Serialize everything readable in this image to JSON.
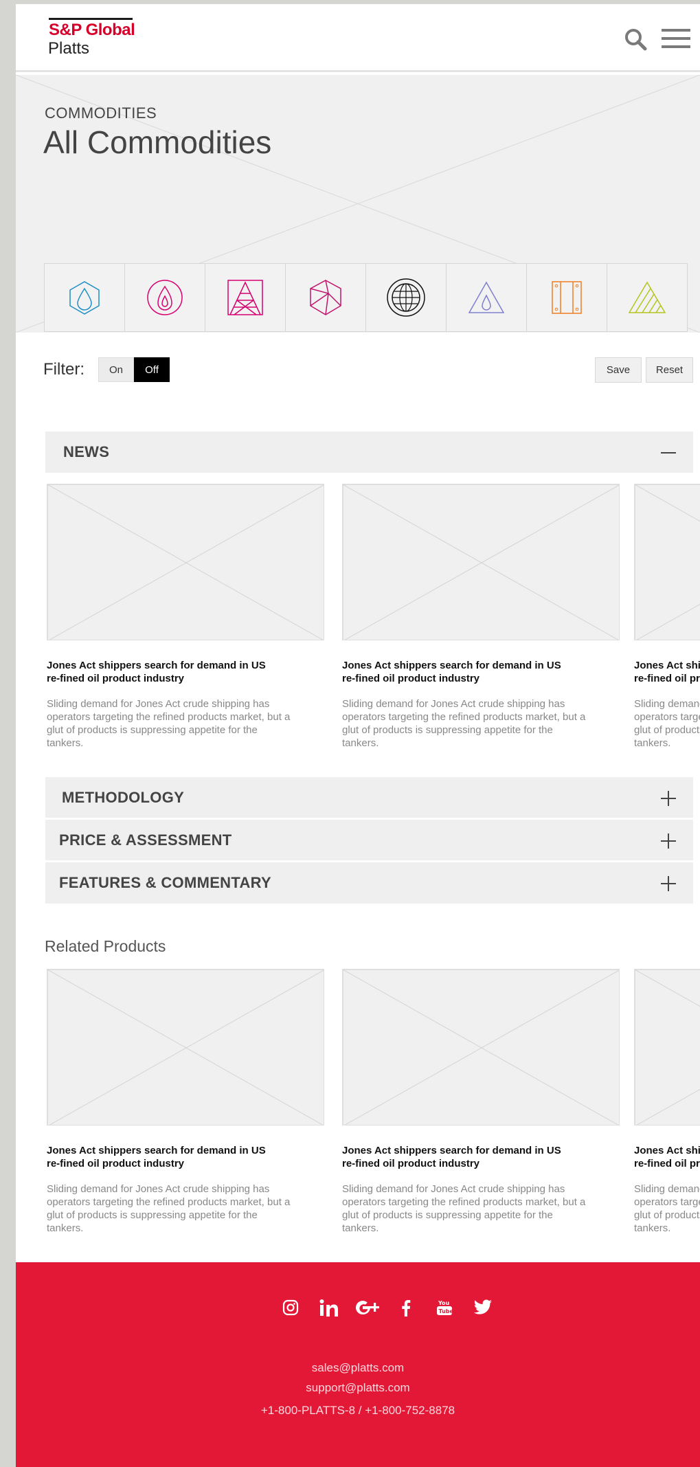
{
  "header": {
    "logo_top": "S&P Global",
    "logo_bottom": "Platts"
  },
  "hero": {
    "eyebrow": "COMMODITIES",
    "title": "All Commodities",
    "commodity_icons": [
      "hexagon-drop-icon",
      "circle-flame-icon",
      "square-tower-icon",
      "polyhedron-icon",
      "globe-icon",
      "triangle-drop-icon",
      "rectangle-panel-icon",
      "striped-triangle-icon"
    ]
  },
  "filter": {
    "label": "Filter:",
    "on_label": "On",
    "off_label": "Off",
    "selected": "Off",
    "save_label": "Save",
    "reset_label": "Reset"
  },
  "news": {
    "title": "NEWS",
    "cards": [
      {
        "title": "Jones Act shippers search for demand in US re-fined oil product industry",
        "desc": "Sliding demand for Jones Act crude shipping has operators targeting the refined products market, but a glut of products is suppressing appetite for the tankers."
      },
      {
        "title": "Jones Act shippers search for demand in US re-fined oil product industry",
        "desc": "Sliding demand for Jones Act crude shipping has operators targeting the refined products market, but a glut of products is suppressing appetite for the tankers."
      },
      {
        "title": "Jones Act shippers search for demand in US re-fined oil product industry",
        "desc": "Sliding demand for Jones Act crude shipping has operators targeting the refined products market, but a glut of products is suppressing appetite for the tankers."
      }
    ]
  },
  "accordions": [
    {
      "title": "METHODOLOGY"
    },
    {
      "title": "PRICE & ASSESSMENT"
    },
    {
      "title": "FEATURES & COMMENTARY"
    }
  ],
  "related": {
    "title": "Related Products",
    "cards": [
      {
        "title": "Jones Act shippers search for demand in US re-fined oil product industry",
        "desc": "Sliding demand for Jones Act crude shipping has operators targeting the refined products market, but a glut of products is suppressing appetite for the tankers."
      },
      {
        "title": "Jones Act shippers search for demand in US re-fined oil product industry",
        "desc": "Sliding demand for Jones Act crude shipping has operators targeting the refined products market, but a glut of products is suppressing appetite for the tankers."
      },
      {
        "title": "Jones Act shippers search for demand in US re-fined oil product industry",
        "desc": "Sliding demand for Jones Act crude shipping has operators targeting the refined products market, but a glut of products is suppressing appetite for the tankers."
      }
    ]
  },
  "footer": {
    "social": [
      "instagram-icon",
      "linkedin-icon",
      "google-plus-icon",
      "facebook-icon",
      "youtube-icon",
      "twitter-icon"
    ],
    "email_sales": "sales@platts.com",
    "email_support": "support@platts.com",
    "phone": "+1-800-PLATTS-8 / +1-800-752-8878"
  },
  "colors": {
    "brand_red": "#e31837",
    "logo_red": "#d6002a",
    "placeholder_gray": "#f0f0f0"
  }
}
